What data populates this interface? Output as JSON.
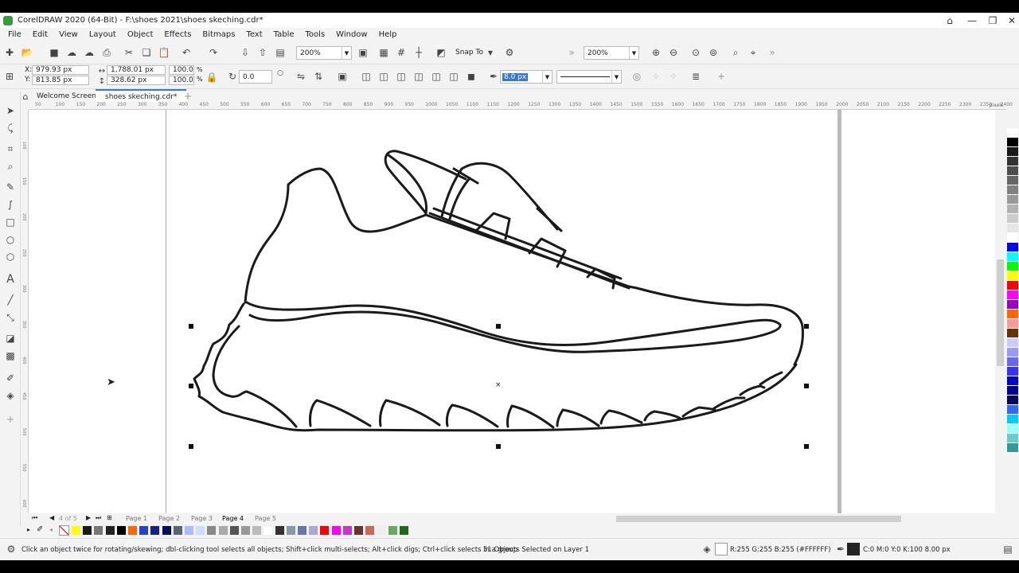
{
  "window": {
    "title": "CorelDRAW 2020 (64-Bit) - F:\\shoes 2021\\shoes skeching.cdr*"
  },
  "menu": [
    "File",
    "Edit",
    "View",
    "Layout",
    "Object",
    "Effects",
    "Bitmaps",
    "Text",
    "Table",
    "Tools",
    "Window",
    "Help"
  ],
  "toolbar": {
    "zoom": "200%",
    "snap": "Snap To",
    "zoom2": "200%"
  },
  "props": {
    "x": "979.93 px",
    "y": "813.85 px",
    "w": "1,788.01 px",
    "h": "328.62 px",
    "sx": "100.0",
    "sy": "100.0",
    "pct": "%",
    "angle": "0.0",
    "outline": "8.0 px",
    "xl": "X:",
    "yl": "Y:"
  },
  "tabs": {
    "welcome": "Welcome Screen",
    "doc": "shoes skeching.cdr*"
  },
  "ruler": {
    "h": [
      "50",
      "100",
      "150",
      "200",
      "250",
      "300",
      "350",
      "400",
      "450",
      "500",
      "550",
      "600",
      "650",
      "700",
      "750",
      "800",
      "850",
      "900",
      "950",
      "1000",
      "1050",
      "1100",
      "1150",
      "1200",
      "1250",
      "1300",
      "1350",
      "1400",
      "1450",
      "1500",
      "1550",
      "1600",
      "1650",
      "1700",
      "1750",
      "1800",
      "1850",
      "1900",
      "1950",
      "2000",
      "2050",
      "2100",
      "2150",
      "2200",
      "2250",
      "2300",
      "2350",
      "2400"
    ],
    "unit": "pixels",
    "v": [
      "100",
      "150",
      "200",
      "250",
      "300",
      "350",
      "400",
      "450",
      "500",
      "550",
      "600"
    ]
  },
  "pages": {
    "nav": "4 of 5",
    "list": [
      "Page 1",
      "Page 2",
      "Page 3",
      "Page 4",
      "Page 5"
    ]
  },
  "status": {
    "hint": "Click an object twice for rotating/skewing; dbl-clicking tool selects all objects; Shift+click multi-selects; Alt+click digs; Ctrl+click selects in a group",
    "selection": "51 Objects Selected on Layer 1",
    "fill": "R:255 G:255 B:255 (#FFFFFF)",
    "outline": "C:0 M:0 Y:0 K:100  8.00 px"
  },
  "colors": {
    "palette": [
      "#ffffff",
      "#000000",
      "#1a1a1a",
      "#333333",
      "#4d4d4d",
      "#666666",
      "#808080",
      "#999999",
      "#b3b3b3",
      "#cccccc",
      "#e6e6e6",
      "#ffffff",
      "#0000ff",
      "#00ffff",
      "#00ff00",
      "#ffff00",
      "#ff0000",
      "#ff00ff",
      "#9900cc",
      "#ff6600",
      "#ff9999",
      "#663300",
      "#ccccff",
      "#9999ff",
      "#6666ff",
      "#3333ff",
      "#0000cc",
      "#000099",
      "#000066",
      "#3366ff",
      "#00ccff",
      "#99ffff",
      "#66cccc",
      "#339999"
    ],
    "docpal": [
      "#ffff00",
      "#1a1a1a",
      "#777777",
      "#222222",
      "#000000",
      "#ff6600",
      "#2244cc",
      "#112288",
      "#001155",
      "#556677",
      "#aabbff",
      "#ccddff",
      "#888888",
      "#aaaaaa",
      "#555555",
      "#999999",
      "#bbbbbb",
      "#ffffff",
      "#333333",
      "#8899aa",
      "#6677aa",
      "#aaaacc",
      "#ff0000",
      "#ff00ff",
      "#cc33cc",
      "#663333",
      "#cc6655",
      "#eeeeee",
      "#66aa66",
      "#226622"
    ]
  }
}
